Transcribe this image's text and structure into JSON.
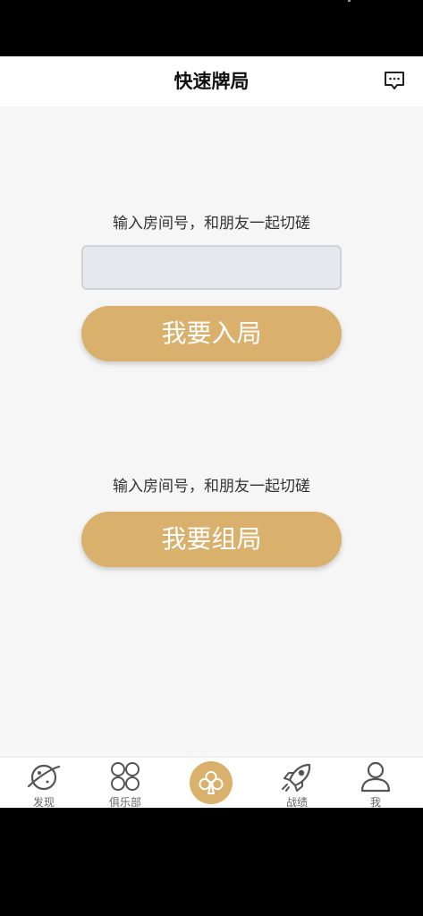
{
  "header": {
    "title": "快速牌局",
    "message_icon": "message-icon"
  },
  "join_section": {
    "hint": "输入房间号，和朋友一起切磋",
    "input_value": "",
    "input_placeholder": "",
    "button_label": "我要入局"
  },
  "create_section": {
    "hint": "输入房间号，和朋友一起切磋",
    "button_label": "我要组局"
  },
  "tab_bar": {
    "items": [
      {
        "label": "发现",
        "icon": "planet-icon"
      },
      {
        "label": "俱乐部",
        "icon": "four-circles-icon"
      },
      {
        "label": "",
        "icon": "club-suit-icon"
      },
      {
        "label": "战绩",
        "icon": "rocket-icon"
      },
      {
        "label": "我",
        "icon": "person-icon"
      }
    ]
  },
  "colors": {
    "accent": "#d9b06c",
    "page_background": "#f6f6f6",
    "input_background": "#e6e8ee"
  }
}
